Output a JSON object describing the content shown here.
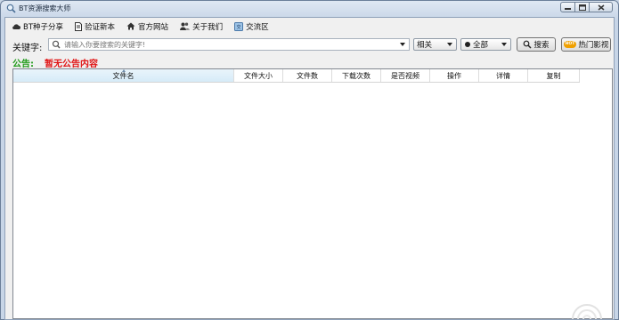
{
  "window": {
    "title": "BT资源搜索大师",
    "controls": [
      "minimize-icon",
      "maximize-icon",
      "close-icon"
    ]
  },
  "menu": [
    {
      "label": "BT种子分享",
      "icon": "cloud-icon"
    },
    {
      "label": "验证新本",
      "icon": "document-icon"
    },
    {
      "label": "官方网站",
      "icon": "home-icon"
    },
    {
      "label": "关于我们",
      "icon": "users-icon"
    },
    {
      "label": "交流区",
      "icon": "chat-icon"
    }
  ],
  "search": {
    "label": "关键字:",
    "placeholder": "请输入你要搜索的关键字!",
    "value": "",
    "sort_selected": "相关",
    "filter_selected": "全部",
    "search_button": "搜索",
    "hot_button": "热门影视",
    "hot_badge": "HOT"
  },
  "notice": {
    "label": "公告:",
    "text": "暂无公告内容"
  },
  "table": {
    "columns": [
      "文件名",
      "文件大小",
      "文件数",
      "下载次数",
      "是否视频",
      "操作",
      "详情",
      "复制"
    ],
    "rows": []
  },
  "colors": {
    "notice_label": "#1f9a18",
    "notice_text": "#e01515",
    "header_selected": "#d6ebf8"
  }
}
